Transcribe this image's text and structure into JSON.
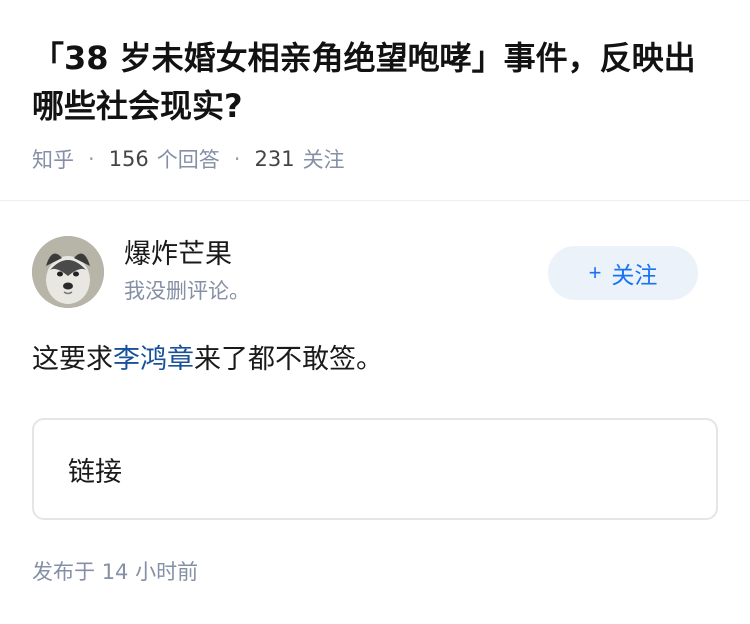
{
  "question": {
    "title": "「38 岁未婚女相亲角绝望咆哮」事件，反映出哪些社会现实?",
    "source": "知乎",
    "answer_count": "156",
    "answer_label": "个回答",
    "follower_count": "231",
    "follower_label": "关注"
  },
  "author": {
    "name": "爆炸芒果",
    "bio": "我没删评论。",
    "avatar_icon": "husky-dog-avatar",
    "follow_label": "关注",
    "follow_icon": "plus-icon",
    "accent": "#1772f6"
  },
  "answer": {
    "text_before": "这要求",
    "link_text": "李鸿章",
    "text_after": "来了都不敢签。",
    "link_color": "#175199"
  },
  "link_card": {
    "label": "链接"
  },
  "footer": {
    "published_prefix": "发布于",
    "published_time": "14 小时前"
  }
}
